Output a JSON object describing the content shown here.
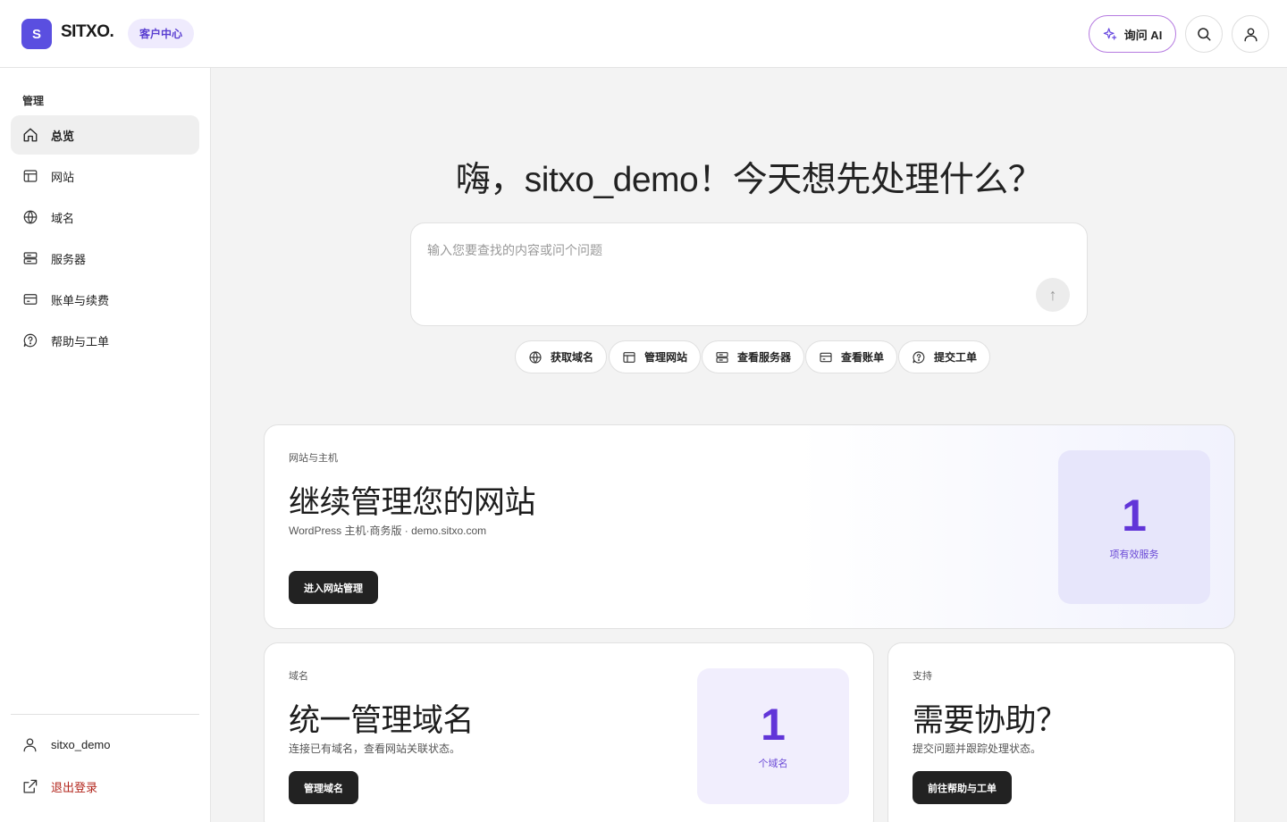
{
  "header": {
    "logo_letter": "S",
    "brand": "SITXO.",
    "center_label": "客户中心",
    "ask_ai_label": "询问 AI"
  },
  "sidebar": {
    "section_label": "管理",
    "items": [
      {
        "label": "总览",
        "icon": "home-icon",
        "active": true
      },
      {
        "label": "网站",
        "icon": "website-icon",
        "active": false
      },
      {
        "label": "域名",
        "icon": "globe-icon",
        "active": false
      },
      {
        "label": "服务器",
        "icon": "server-icon",
        "active": false
      },
      {
        "label": "账单与续费",
        "icon": "credit-card-icon",
        "active": false
      },
      {
        "label": "帮助与工单",
        "icon": "help-icon",
        "active": false
      }
    ],
    "username": "sitxo_demo",
    "logout_label": "退出登录"
  },
  "main": {
    "greeting": "嗨，sitxo_demo！今天想先处理什么？",
    "search": {
      "placeholder": "输入您要查找的内容或问个问题",
      "value": ""
    },
    "send_glyph": "↑",
    "quick_actions": [
      {
        "label": "获取域名",
        "icon": "globe-icon"
      },
      {
        "label": "管理网站",
        "icon": "website-icon"
      },
      {
        "label": "查看服务器",
        "icon": "server-icon"
      },
      {
        "label": "查看账单",
        "icon": "credit-card-icon"
      },
      {
        "label": "提交工单",
        "icon": "help-icon"
      }
    ]
  },
  "cards": {
    "website": {
      "eyebrow": "网站与主机",
      "title": "继续管理您的网站",
      "desc": "WordPress 主机·商务版 · demo.sitxo.com",
      "button": "进入网站管理",
      "stat_value": "1",
      "stat_label": "项有效服务"
    },
    "domain": {
      "eyebrow": "域名",
      "title": "统一管理域名",
      "desc": "连接已有域名，查看网站关联状态。",
      "button": "管理域名",
      "stat_value": "1",
      "stat_label": "个域名"
    },
    "support": {
      "eyebrow": "支持",
      "title": "需要协助？",
      "desc": "提交问题并跟踪处理状态。",
      "button": "前往帮助与工单"
    }
  },
  "colors": {
    "accent": "#5a4fe0",
    "stat_number": "#6135d8",
    "logout": "#b3271e"
  }
}
